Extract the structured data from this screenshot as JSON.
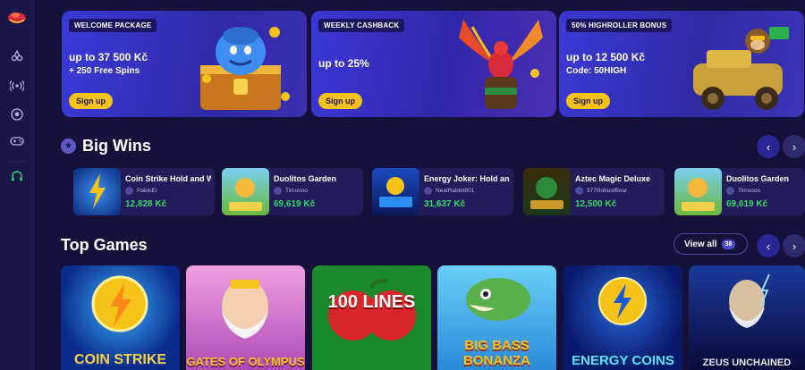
{
  "sidebar": {
    "items": [
      {
        "icon": "cherries-icon"
      },
      {
        "icon": "live-broadcast-icon"
      },
      {
        "icon": "soccer-ball-icon"
      },
      {
        "icon": "gamepad-icon"
      },
      {
        "icon": "headset-icon"
      }
    ]
  },
  "promos": [
    {
      "tag": "WELCOME PACKAGE",
      "title": "up to 37 500 Kč",
      "subtitle": "+ 250 Free Spins",
      "button": "Sign up"
    },
    {
      "tag": "WEEKLY CASHBACK",
      "title": "up to 25%",
      "subtitle": "",
      "button": "Sign up"
    },
    {
      "tag": "50% HIGHROLLER BONUS",
      "title": "up to 12 500 Kč",
      "subtitle": "Code: 50HIGH",
      "button": "Sign up"
    }
  ],
  "big_wins": {
    "title": "Big Wins",
    "items": [
      {
        "game": "Coin Strike Hold and Win",
        "user": "PabloEr",
        "amount": "12,828 Kč"
      },
      {
        "game": "Duolitos Garden",
        "user": "Timoooo",
        "amount": "69,619 Kč"
      },
      {
        "game": "Energy Joker: Hold and Win",
        "user": "NeatRabbit801",
        "amount": "31,637 Kč"
      },
      {
        "game": "Aztec Magic Deluxe",
        "user": "977RobustBear",
        "amount": "12,500 Kč"
      },
      {
        "game": "Duolitos Garden",
        "user": "Timoooo",
        "amount": "69,619 Kč"
      }
    ]
  },
  "top_games": {
    "title": "Top Games",
    "view_all": "View all",
    "count": "38",
    "tiles": [
      {
        "label": "COIN STRIKE"
      },
      {
        "label": "GATES OF OLYMPUS"
      },
      {
        "label": "100 LINES"
      },
      {
        "label": "BIG BASS BONANZA"
      },
      {
        "label": "ENERGY COINS"
      },
      {
        "label": "ZEUS UNCHAINED"
      }
    ]
  },
  "colors": {
    "background": "#15113a",
    "accent_yellow": "#f7c21a",
    "win_green": "#37d96a",
    "card": "#221c5a"
  }
}
